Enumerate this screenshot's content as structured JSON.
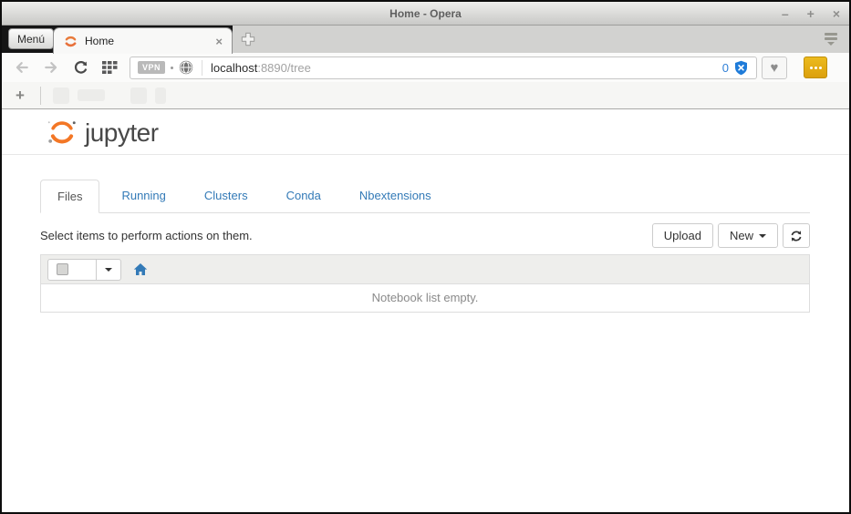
{
  "titlebar": {
    "title": "Home - Opera",
    "minimize": "–",
    "maximize": "+",
    "close": "×"
  },
  "tabbar": {
    "menu_button": "Menú",
    "active_tab": "Home",
    "close_tab": "×"
  },
  "toolbar": {
    "vpn_badge": "VPN",
    "url": {
      "host": "localhost",
      "path": ":8890/tree"
    },
    "blocked_count": "0",
    "heart_icon": "♥"
  },
  "bookmarks": {
    "new_item": "+"
  },
  "page": {
    "logo": "jupyter",
    "nav_tabs": [
      {
        "label": "Files",
        "active": true
      },
      {
        "label": "Running",
        "active": false
      },
      {
        "label": "Clusters",
        "active": false
      },
      {
        "label": "Conda",
        "active": false
      },
      {
        "label": "Nbextensions",
        "active": false
      }
    ],
    "select_text": "Select items to perform actions on them.",
    "upload_button": "Upload",
    "new_button": "New",
    "empty_message": "Notebook list empty."
  },
  "colors": {
    "accent_blue": "#337ab7",
    "jupyter_orange": "#f37726",
    "shield_blue": "#1e7bd9",
    "sidebar_yellow": "#e2a713",
    "tabbar_dark": "#151515"
  }
}
